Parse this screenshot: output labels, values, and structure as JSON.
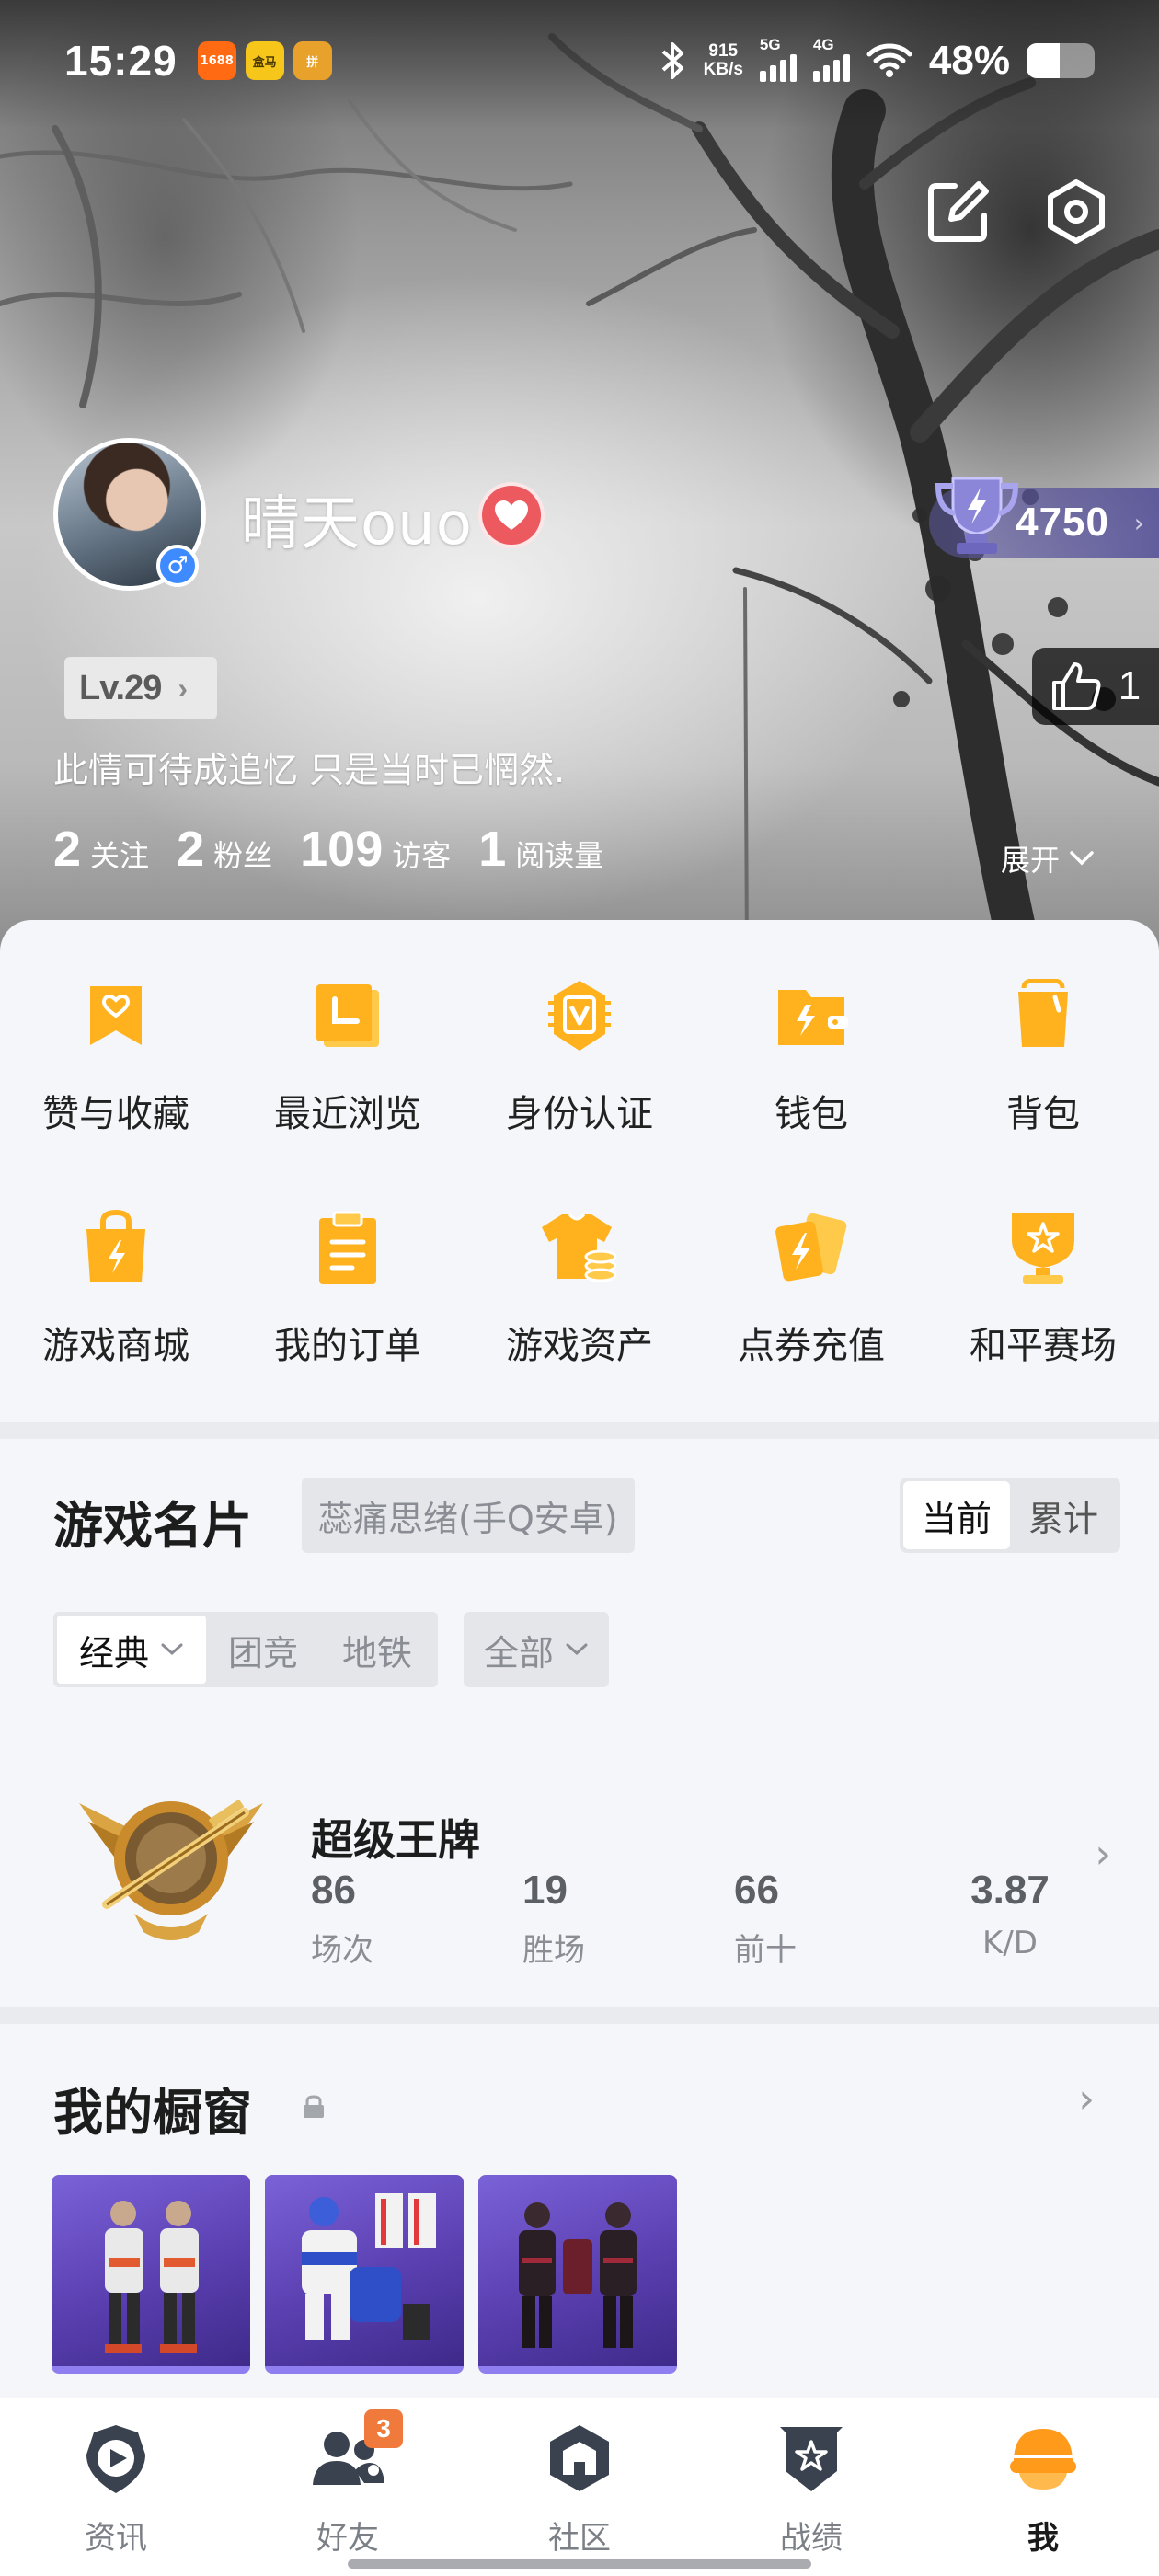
{
  "status_bar": {
    "time": "15:29",
    "app_badges": [
      {
        "text": "1688",
        "color": "#ff6a13"
      },
      {
        "text": "盒马",
        "color": "#f7c61a"
      },
      {
        "text": "拼",
        "color": "#e8a22b"
      }
    ],
    "net_speed_value": "915",
    "net_speed_unit": "KB/s",
    "sig1_label": "5G",
    "sig2_label": "4G",
    "battery_percent": "48%",
    "battery_level": 0.48
  },
  "profile": {
    "username": "晴天ouo",
    "gender_symbol": "♂",
    "trophy_points": "4750",
    "level": "Lv.29",
    "likes": "1",
    "bio": "此情可待成追忆 只是当时已惘然.",
    "stats": [
      {
        "value": "2",
        "label": "关注"
      },
      {
        "value": "2",
        "label": "粉丝"
      },
      {
        "value": "109",
        "label": "访客"
      },
      {
        "value": "1",
        "label": "阅读量"
      }
    ],
    "expand_label": "展开"
  },
  "menu": {
    "items": [
      {
        "label": "赞与收藏",
        "icon": "heart-bookmark-icon"
      },
      {
        "label": "最近浏览",
        "icon": "history-folder-icon"
      },
      {
        "label": "身份认证",
        "icon": "verified-v-icon"
      },
      {
        "label": "钱包",
        "icon": "wallet-icon"
      },
      {
        "label": "背包",
        "icon": "backpack-icon"
      },
      {
        "label": "游戏商城",
        "icon": "shopping-bag-icon"
      },
      {
        "label": "我的订单",
        "icon": "clipboard-icon"
      },
      {
        "label": "游戏资产",
        "icon": "tshirt-coins-icon"
      },
      {
        "label": "点券充值",
        "icon": "cards-bolt-icon"
      },
      {
        "label": "和平赛场",
        "icon": "trophy-star-icon"
      }
    ],
    "accent_color": "#ffb21e"
  },
  "game_card": {
    "title": "游戏名片",
    "server": "蕊痛思绪(手Q安卓)",
    "segments": [
      "当前",
      "累计"
    ],
    "mode_group": [
      "经典",
      "团竞",
      "地铁"
    ],
    "mode_filter": "全部",
    "rank": {
      "name": "超级王牌",
      "stats": [
        {
          "value": "86",
          "label": "场次"
        },
        {
          "value": "19",
          "label": "胜场"
        },
        {
          "value": "66",
          "label": "前十"
        },
        {
          "value": "3.87",
          "label": "K/D"
        }
      ]
    }
  },
  "showcase": {
    "title": "我的橱窗",
    "items": [
      "outfit-1",
      "outfit-2",
      "outfit-3"
    ]
  },
  "tabbar": {
    "tabs": [
      {
        "label": "资讯",
        "icon": "news-play-icon"
      },
      {
        "label": "好友",
        "icon": "friends-icon",
        "badge": "3"
      },
      {
        "label": "社区",
        "icon": "community-hex-icon"
      },
      {
        "label": "战绩",
        "icon": "record-shield-icon"
      },
      {
        "label": "我",
        "icon": "helmet-me-icon"
      }
    ],
    "active_index": 4
  }
}
